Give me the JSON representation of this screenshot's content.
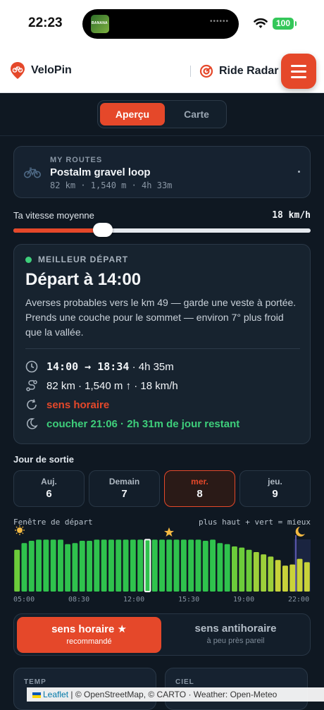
{
  "status": {
    "time": "22:23",
    "battery": "100",
    "island_thumb_text": "BANANA"
  },
  "header": {
    "brand": "VeloPin",
    "radar": "Ride Radar"
  },
  "tabs": [
    {
      "label": "Aperçu",
      "active": true
    },
    {
      "label": "Carte",
      "active": false
    }
  ],
  "route": {
    "section": "MY ROUTES",
    "name": "Postalm gravel loop",
    "meta": "82 km · 1,540 m · 4h 33m"
  },
  "speed": {
    "label": "Ta vitesse moyenne",
    "value": "18 km/h",
    "fill_fraction": 0.3
  },
  "best": {
    "kicker": "MEILLEUR DÉPART",
    "title": "Départ à 14:00",
    "description": "Averses probables vers le km 49 — garde une veste à portée. Prends une couche pour le sommet — environ 7° plus froid que la vallée.",
    "times": "14:00 → 18:34",
    "duration": "· 4h 35m",
    "stats": "82 km · 1,540 m ↑ · 18 km/h",
    "direction": "sens horaire",
    "sunset": "coucher 21:06 · 2h 31m de jour restant",
    "colors": {
      "accent": "#e5482a",
      "good": "#3ecf7b"
    }
  },
  "days": {
    "title": "Jour de sortie",
    "items": [
      {
        "label": "Auj.",
        "num": "6",
        "selected": false
      },
      {
        "label": "Demain",
        "num": "7",
        "selected": false
      },
      {
        "label": "mer.",
        "num": "8",
        "selected": true
      },
      {
        "label": "jeu.",
        "num": "9",
        "selected": false
      }
    ]
  },
  "window": {
    "label": "Fenêtre de départ",
    "note": "plus haut + vert = mieux",
    "ticks": [
      "05:00",
      "08:30",
      "12:00",
      "15:30",
      "19:00",
      "22:00"
    ],
    "scores": [
      0.74,
      0.86,
      0.9,
      0.92,
      0.92,
      0.92,
      0.92,
      0.84,
      0.86,
      0.9,
      0.9,
      0.92,
      0.92,
      0.92,
      0.92,
      0.92,
      0.92,
      0.92,
      0.92,
      0.92,
      0.92,
      0.92,
      0.92,
      0.92,
      0.92,
      0.92,
      0.9,
      0.92,
      0.86,
      0.84,
      0.8,
      0.78,
      0.74,
      0.7,
      0.66,
      0.62,
      0.56,
      0.46,
      0.48,
      0.58,
      0.52
    ],
    "selected_index": 18
  },
  "direction": {
    "on": {
      "title": "sens horaire ★",
      "sub": "recommandé"
    },
    "off": {
      "title": "sens antihoraire",
      "sub": "à peu près pareil"
    }
  },
  "bottom": {
    "temp": "TEMP",
    "sky": "CIEL"
  },
  "attribution": {
    "leaflet": "Leaflet",
    "rest": " | © OpenStreetMap, © CARTO · Weather: Open-Meteo"
  }
}
